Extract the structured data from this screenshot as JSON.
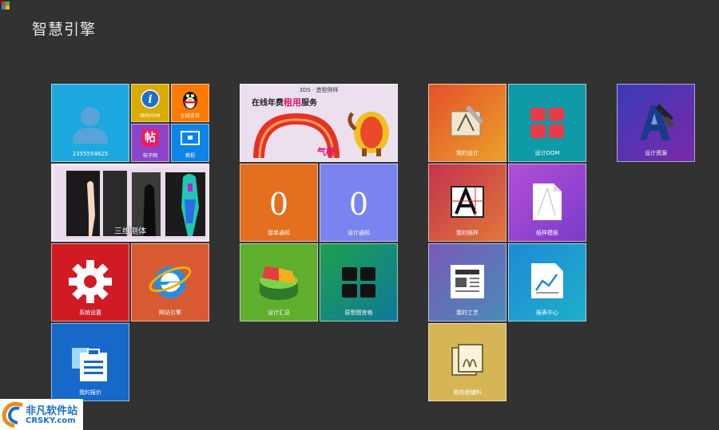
{
  "app": {
    "title": "智慧引擎"
  },
  "tiles": {
    "user_id": "2355554625",
    "intro_pdm": "国岳PDM",
    "online_support": "在线支持",
    "tiezi": "帖子网",
    "tutorial": "教程",
    "body_measure": "三维测体",
    "banner": {
      "top_text": "3DS · 造型例样",
      "main_text_a": "在线年费",
      "main_text_b": "租用",
      "main_text_c": "服务",
      "bottom_text": "气模"
    },
    "order_notice": {
      "count": "0",
      "label": "接单通知"
    },
    "design_notice": {
      "count": "0",
      "label": "设计通知"
    },
    "system_settings": "系统设置",
    "website_engine": "网站引擎",
    "design_summary": "设计汇总",
    "pattern_grid": "原型图宫格",
    "my_designs": "我的设计",
    "design_dom": "设计DOM",
    "design_resources": "设计资源",
    "my_patterns": "我的纸样",
    "pattern_templates": "纸样模板",
    "my_process": "我的工艺",
    "report_center": "报表中心",
    "my_quotes": "我的报价",
    "my_materials": "我的面辅料"
  },
  "watermark": {
    "brand": "非凡软件站",
    "domain": "CRSKY.com"
  }
}
